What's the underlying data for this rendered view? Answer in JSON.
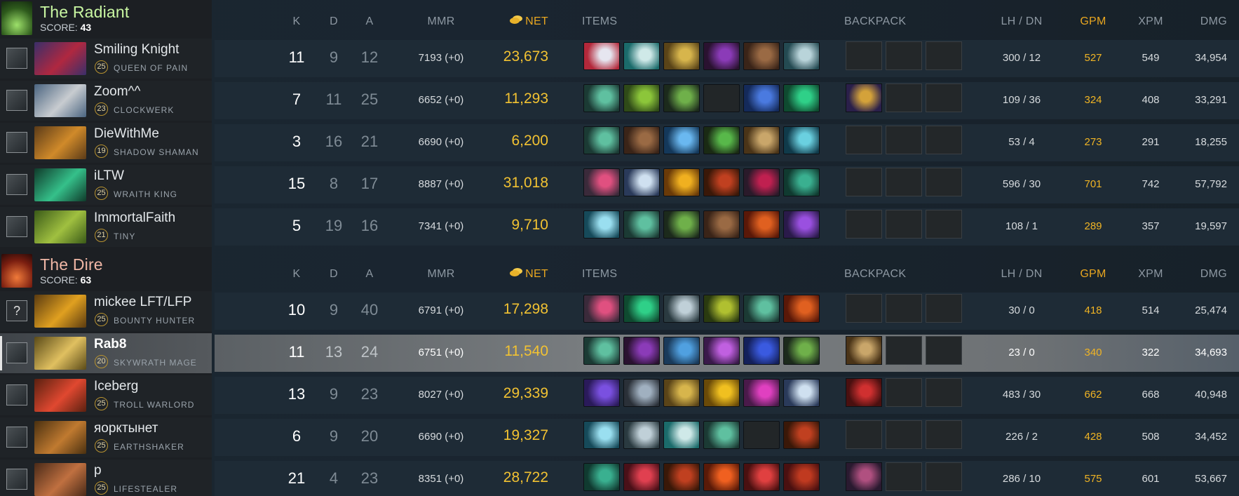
{
  "columns": {
    "k": "K",
    "d": "D",
    "a": "A",
    "mmr": "MMR",
    "net": "NET",
    "items": "ITEMS",
    "backpack": "BACKPACK",
    "lh": "LH",
    "sep": "/",
    "dn": "DN",
    "gpm": "GPM",
    "xpm": "XPM",
    "dmg": "DMG"
  },
  "colors": {
    "radiant": "#c9f7a2",
    "dire": "#f0b7a6",
    "gold": "#f2c232"
  },
  "teams": [
    {
      "name": "The Radiant",
      "score_label": "SCORE:",
      "score": "43",
      "players": [
        {
          "name": "Smiling Knight",
          "level": "25",
          "hero": "QUEEN OF PAIN",
          "k": "11",
          "d": "9",
          "a": "12",
          "mmr": "7193 (+0)",
          "net": "23,673",
          "lh": "300",
          "dn": "12",
          "gpm": "527",
          "xpm": "549",
          "dmg": "34,954",
          "portrait_icon": "banner-icon",
          "hero_colors": [
            "#3a2f6a",
            "#b02840"
          ],
          "items": [
            {
              "name": "butterfly-icon",
              "colors": [
                "#b3283a",
                "#e6e6f0"
              ]
            },
            {
              "name": "eul-scepter-icon",
              "colors": [
                "#1b6b6b",
                "#cfe9e8"
              ]
            },
            {
              "name": "helm-icon",
              "colors": [
                "#5a4418",
                "#d7b54c"
              ]
            },
            {
              "name": "veil-icon",
              "colors": [
                "#2a1230",
                "#8b3bb8"
              ]
            },
            {
              "name": "boots-icon",
              "colors": [
                "#3a2418",
                "#9a6a44"
              ]
            },
            {
              "name": "skull-basher-icon",
              "colors": [
                "#244a52",
                "#b9d4da"
              ]
            }
          ],
          "backpack": [
            null,
            null,
            null
          ]
        },
        {
          "name": "Zoom^^",
          "level": "23",
          "hero": "CLOCKWERK",
          "k": "7",
          "d": "11",
          "a": "25",
          "mmr": "6652 (+0)",
          "net": "11,293",
          "lh": "109",
          "dn": "36",
          "gpm": "324",
          "xpm": "408",
          "dmg": "33,291",
          "portrait_icon": "clock-icon",
          "hero_colors": [
            "#4a6480",
            "#c8ccd0"
          ],
          "items": [
            {
              "name": "staff-icon",
              "colors": [
                "#1b3a34",
                "#5fc0a0"
              ]
            },
            {
              "name": "orb-green-icon",
              "colors": [
                "#2f4a18",
                "#8cc63a"
              ]
            },
            {
              "name": "wand-icon",
              "colors": [
                "#1c2a1c",
                "#6fb04a"
              ]
            },
            null,
            {
              "name": "scepter-blue-icon",
              "colors": [
                "#142a5a",
                "#4a7ae0"
              ]
            },
            {
              "name": "tranquil-boots-icon",
              "colors": [
                "#0f4a30",
                "#2fd088"
              ]
            }
          ],
          "backpack": [
            {
              "name": "bottle-icon",
              "colors": [
                "#2a1f4a",
                "#d4a23a"
              ]
            },
            null,
            null
          ]
        },
        {
          "name": "DieWithMe",
          "level": "19",
          "hero": "SHADOW SHAMAN",
          "k": "3",
          "d": "16",
          "a": "21",
          "mmr": "6690 (+0)",
          "net": "6,200",
          "lh": "53",
          "dn": "4",
          "gpm": "273",
          "xpm": "291",
          "dmg": "18,255",
          "portrait_icon": "mask-icon",
          "hero_colors": [
            "#5a3a18",
            "#d08a2a"
          ],
          "items": [
            {
              "name": "staff-icon",
              "colors": [
                "#1b3a34",
                "#5fc0a0"
              ]
            },
            {
              "name": "boots-icon",
              "colors": [
                "#3a2418",
                "#9a6a44"
              ]
            },
            {
              "name": "glimmer-icon",
              "colors": [
                "#14385a",
                "#6ab8f0"
              ]
            },
            {
              "name": "blink-icon",
              "colors": [
                "#1a2a14",
                "#58b84a"
              ]
            },
            {
              "name": "scroll-icon",
              "colors": [
                "#4a3418",
                "#c9a66a"
              ]
            },
            {
              "name": "force-staff-icon",
              "colors": [
                "#103a4a",
                "#6ad0e0"
              ]
            }
          ],
          "backpack": [
            null,
            null,
            null
          ]
        },
        {
          "name": "iLTW",
          "level": "25",
          "hero": "WRAITH KING",
          "k": "15",
          "d": "8",
          "a": "17",
          "mmr": "8887 (+0)",
          "net": "31,018",
          "lh": "596",
          "dn": "30",
          "gpm": "701",
          "xpm": "742",
          "dmg": "57,792",
          "portrait_icon": "crown-icon",
          "hero_colors": [
            "#0f3a2a",
            "#35c08a"
          ],
          "items": [
            {
              "name": "lotus-icon",
              "colors": [
                "#3a2a3a",
                "#e05080"
              ]
            },
            {
              "name": "desolator-icon",
              "colors": [
                "#2a3a5a",
                "#cfe0f0"
              ]
            },
            {
              "name": "daedalus-icon",
              "colors": [
                "#6a3a08",
                "#f0b020"
              ]
            },
            {
              "name": "blade-mail-icon",
              "colors": [
                "#3a1808",
                "#c04020"
              ]
            },
            {
              "name": "satanic-icon",
              "colors": [
                "#2a1a2a",
                "#c02050"
              ]
            },
            {
              "name": "assault-icon",
              "colors": [
                "#103a30",
                "#3ab090"
              ]
            }
          ],
          "backpack": [
            null,
            null,
            null
          ]
        },
        {
          "name": "ImmortalFaith",
          "level": "21",
          "hero": "TINY",
          "k": "5",
          "d": "19",
          "a": "16",
          "mmr": "7341 (+0)",
          "net": "9,710",
          "lh": "108",
          "dn": "1",
          "gpm": "289",
          "xpm": "357",
          "dmg": "19,597",
          "portrait_icon": "bars-icon",
          "hero_colors": [
            "#3a5a18",
            "#a0c040"
          ],
          "items": [
            {
              "name": "skadi-icon",
              "colors": [
                "#164a5a",
                "#9adff0"
              ]
            },
            {
              "name": "staff-icon",
              "colors": [
                "#1b3a34",
                "#5fc0a0"
              ]
            },
            {
              "name": "wand-icon",
              "colors": [
                "#1c2a1c",
                "#6fb04a"
              ]
            },
            {
              "name": "boots-icon",
              "colors": [
                "#3a2418",
                "#9a6a44"
              ]
            },
            {
              "name": "pipe-icon",
              "colors": [
                "#5a1808",
                "#e06020"
              ]
            },
            {
              "name": "orb-purple-icon",
              "colors": [
                "#2a1a4a",
                "#9a50e0"
              ]
            }
          ],
          "backpack": [
            null,
            null,
            null
          ]
        }
      ]
    },
    {
      "name": "The Dire",
      "score_label": "SCORE:",
      "score": "63",
      "players": [
        {
          "name": "mickee LFT/LFP",
          "level": "25",
          "hero": "BOUNTY HUNTER",
          "k": "10",
          "d": "9",
          "a": "40",
          "mmr": "6791 (+0)",
          "net": "17,298",
          "lh": "30",
          "dn": "0",
          "gpm": "418",
          "xpm": "514",
          "dmg": "25,474",
          "portrait_icon": "question-icon",
          "portrait_text": "?",
          "hero_colors": [
            "#5a3a10",
            "#e0a020"
          ],
          "items": [
            {
              "name": "lotus-icon",
              "colors": [
                "#3a2a3a",
                "#e05080"
              ]
            },
            {
              "name": "tranquil-boots-icon",
              "colors": [
                "#0f4a30",
                "#2fd088"
              ]
            },
            {
              "name": "blades-icon",
              "colors": [
                "#2a3a40",
                "#c0d0d8"
              ]
            },
            {
              "name": "helm-green-icon",
              "colors": [
                "#2a3a10",
                "#b0c030"
              ]
            },
            {
              "name": "staff-icon",
              "colors": [
                "#1b3a34",
                "#5fc0a0"
              ]
            },
            {
              "name": "pipe-icon",
              "colors": [
                "#5a1808",
                "#e06020"
              ]
            }
          ],
          "backpack": [
            null,
            null,
            null
          ]
        },
        {
          "name": "Rab8",
          "level": "20",
          "hero": "SKYWRATH MAGE",
          "k": "11",
          "d": "13",
          "a": "24",
          "mmr": "6751 (+0)",
          "net": "11,540",
          "lh": "23",
          "dn": "0",
          "gpm": "340",
          "xpm": "322",
          "dmg": "34,693",
          "selected": true,
          "portrait_icon": "deer-icon",
          "hero_colors": [
            "#5a4a18",
            "#e0c060"
          ],
          "items": [
            {
              "name": "staff-icon",
              "colors": [
                "#1b3a34",
                "#5fc0a0"
              ]
            },
            {
              "name": "veil-icon",
              "colors": [
                "#2a1230",
                "#8b3bb8"
              ]
            },
            {
              "name": "mekansm-icon",
              "colors": [
                "#1a3a5a",
                "#50a0e0"
              ]
            },
            {
              "name": "orb-purple-icon",
              "colors": [
                "#3a1a4a",
                "#c060e0"
              ]
            },
            {
              "name": "cloak-icon",
              "colors": [
                "#14205a",
                "#3a5ae0"
              ]
            },
            {
              "name": "wand-icon",
              "colors": [
                "#1c2a1c",
                "#6fb04a"
              ]
            }
          ],
          "backpack": [
            {
              "name": "scroll-icon",
              "colors": [
                "#4a3418",
                "#c9a66a"
              ]
            },
            null,
            null
          ]
        },
        {
          "name": "Iceberg",
          "level": "25",
          "hero": "TROLL WARLORD",
          "k": "13",
          "d": "9",
          "a": "23",
          "mmr": "8027 (+0)",
          "net": "29,339",
          "lh": "483",
          "dn": "30",
          "gpm": "662",
          "xpm": "668",
          "dmg": "40,948",
          "portrait_icon": "sword-icon",
          "hero_colors": [
            "#5a2010",
            "#e04830"
          ],
          "items": [
            {
              "name": "claw-icon",
              "colors": [
                "#2a1a5a",
                "#7a50e0"
              ]
            },
            {
              "name": "basher-icon",
              "colors": [
                "#2a3038",
                "#a0b0c0"
              ]
            },
            {
              "name": "helm-icon",
              "colors": [
                "#5a4418",
                "#d7b54c"
              ]
            },
            {
              "name": "gold-icon",
              "colors": [
                "#6a4a08",
                "#f0c020"
              ]
            },
            {
              "name": "manta-icon",
              "colors": [
                "#4a1a4a",
                "#e040c0"
              ]
            },
            {
              "name": "desolator-icon",
              "colors": [
                "#2a3a5a",
                "#cfe0f0"
              ]
            }
          ],
          "backpack": [
            {
              "name": "armlet-icon",
              "colors": [
                "#4a1010",
                "#d03030"
              ]
            },
            null,
            null
          ]
        },
        {
          "name": "яорктынет",
          "level": "25",
          "hero": "EARTHSHAKER",
          "k": "6",
          "d": "9",
          "a": "20",
          "mmr": "6690 (+0)",
          "net": "19,327",
          "lh": "226",
          "dn": "2",
          "gpm": "428",
          "xpm": "508",
          "dmg": "34,452",
          "portrait_icon": "totem-icon",
          "hero_colors": [
            "#4a3010",
            "#c07a30"
          ],
          "items": [
            {
              "name": "skadi-icon",
              "colors": [
                "#164a5a",
                "#9adff0"
              ]
            },
            {
              "name": "blades-icon",
              "colors": [
                "#2a3a40",
                "#c0d0d8"
              ]
            },
            {
              "name": "eul-scepter-icon",
              "colors": [
                "#1b6b6b",
                "#cfe9e8"
              ]
            },
            {
              "name": "staff-icon",
              "colors": [
                "#1b3a34",
                "#5fc0a0"
              ]
            },
            null,
            {
              "name": "blade-mail-icon",
              "colors": [
                "#3a1808",
                "#c04020"
              ]
            }
          ],
          "backpack": [
            null,
            null,
            null
          ]
        },
        {
          "name": "p",
          "level": "25",
          "hero": "LIFESTEALER",
          "k": "21",
          "d": "4",
          "a": "23",
          "mmr": "8351 (+0)",
          "net": "28,722",
          "lh": "286",
          "dn": "10",
          "gpm": "575",
          "xpm": "601",
          "dmg": "53,667",
          "portrait_icon": "ghoul-icon",
          "hero_colors": [
            "#4a2a18",
            "#c07040"
          ],
          "items": [
            {
              "name": "assault-icon",
              "colors": [
                "#103a30",
                "#3ab090"
              ]
            },
            {
              "name": "sange-icon",
              "colors": [
                "#4a1018",
                "#e04050"
              ]
            },
            {
              "name": "blade-mail-icon",
              "colors": [
                "#3a1808",
                "#c04020"
              ]
            },
            {
              "name": "radiance-icon",
              "colors": [
                "#5a1a08",
                "#f06020"
              ]
            },
            {
              "name": "yasha-icon",
              "colors": [
                "#4a1010",
                "#e04040"
              ]
            },
            {
              "name": "helm-red-icon",
              "colors": [
                "#4a1010",
                "#c03a20"
              ]
            }
          ],
          "backpack": [
            {
              "name": "dagger-icon",
              "colors": [
                "#2a1a30",
                "#b05080"
              ]
            },
            null,
            null
          ]
        }
      ]
    }
  ]
}
